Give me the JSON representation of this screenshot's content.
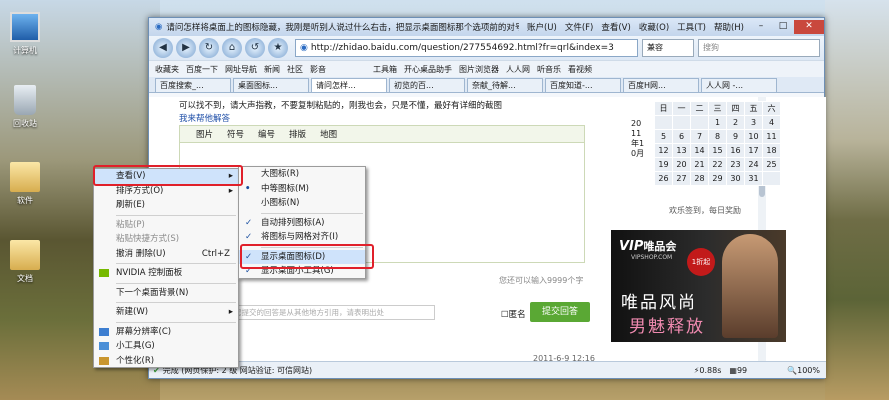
{
  "desktop": {
    "icons": [
      {
        "label": "计算机"
      },
      {
        "label": "回收站"
      },
      {
        "label": "软件"
      },
      {
        "label": "文档"
      }
    ]
  },
  "browser": {
    "title": "请问怎样将桌面上的图标隐藏，我刚是听别人说过什么右击，把显示桌面图标那个选项前的对号点掉，_百...",
    "menus": [
      "账户(U)",
      "文件(F)",
      "查看(V)",
      "收藏(O)",
      "工具(T)",
      "帮助(H)"
    ],
    "url": "http://zhidao.baidu.com/question/277554692.html?fr=qrl&index=3",
    "compat": "兼容",
    "search_placeholder": "搜狗",
    "favorites": [
      "收藏夹",
      "百度一下",
      "网址导航",
      "新闻",
      "社区",
      "影音",
      "工具箱",
      "开心桌品助手",
      "图片浏览器",
      "人人网",
      "听音乐",
      "看视频"
    ],
    "tabs": [
      "百度搜索_...",
      "桌面图标...",
      "请问怎样...",
      "初览的百...",
      "奈献_待解...",
      "百度知道-...",
      "百度H网...",
      "人人网 -..."
    ],
    "page": {
      "top_text": "可以找不到，请大声指教，不要复制粘贴的，刚我也会，只是不懂，最好有详细的截图",
      "fold_link": "我来帮他解答",
      "editor_tools": [
        "图片",
        "符号",
        "编号",
        "排版",
        "地图"
      ],
      "char_hint": "您还可以输入9999个字",
      "ref_placeholder": "您提交的回答是从其他地方引用，请表明出处",
      "anon_label": "匿名",
      "submit_label": "提交回答",
      "date": "2011-6-9 12:16"
    },
    "calendar": {
      "weekdays": [
        "日",
        "一",
        "二",
        "三",
        "四",
        "五",
        "六"
      ],
      "rows": [
        [
          "",
          "",
          "",
          "1",
          "2",
          "3",
          "4"
        ],
        [
          "5",
          "6",
          "7",
          "8",
          "9",
          "10",
          "11"
        ],
        [
          "12",
          "13",
          "14",
          "15",
          "16",
          "17",
          "18"
        ],
        [
          "19",
          "20",
          "21",
          "22",
          "23",
          "24",
          "25"
        ],
        [
          "26",
          "27",
          "28",
          "29",
          "30",
          "31",
          ""
        ]
      ],
      "month_label": "2011年10月",
      "footer": "欢乐签到，每日奖励"
    },
    "ad": {
      "brand": "唯品会",
      "brand_url": "VIPSHOP.COM",
      "slogan1": "唯品风尚",
      "slogan2": "男魅释放",
      "badge": "1折起"
    },
    "status": {
      "text": "完成 (网页保护: 2 级  网站验证: 可信网站)",
      "speed": "0.88s",
      "count": "99",
      "zoom": "100%"
    }
  },
  "context_menu": {
    "items": [
      {
        "label": "查看(V)",
        "arrow": "▸"
      },
      {
        "label": "排序方式(O)",
        "arrow": "▸"
      },
      {
        "label": "刷新(E)"
      },
      {
        "label": "粘贴(P)"
      },
      {
        "label": "粘贴快捷方式(S)"
      },
      {
        "label": "撤消 删除(U)",
        "accel": "Ctrl+Z"
      },
      {
        "label": "NVIDIA 控制面板"
      },
      {
        "label": "下一个桌面背景(N)"
      },
      {
        "label": "新建(W)",
        "arrow": "▸"
      },
      {
        "label": "屏幕分辨率(C)"
      },
      {
        "label": "小工具(G)"
      },
      {
        "label": "个性化(R)"
      }
    ]
  },
  "submenu": {
    "items": [
      {
        "label": "大图标(R)"
      },
      {
        "label": "中等图标(M)"
      },
      {
        "label": "小图标(N)"
      },
      {
        "label": "自动排列图标(A)"
      },
      {
        "label": "将图标与网格对齐(I)"
      },
      {
        "label": "显示桌面图标(D)"
      },
      {
        "label": "显示桌面小工具(G)"
      }
    ]
  },
  "colors": {
    "highlight": "#e0202a",
    "menu_bg": "#f7f7f7",
    "title_bar": "#c4d6ec",
    "submit": "#5aa834"
  }
}
